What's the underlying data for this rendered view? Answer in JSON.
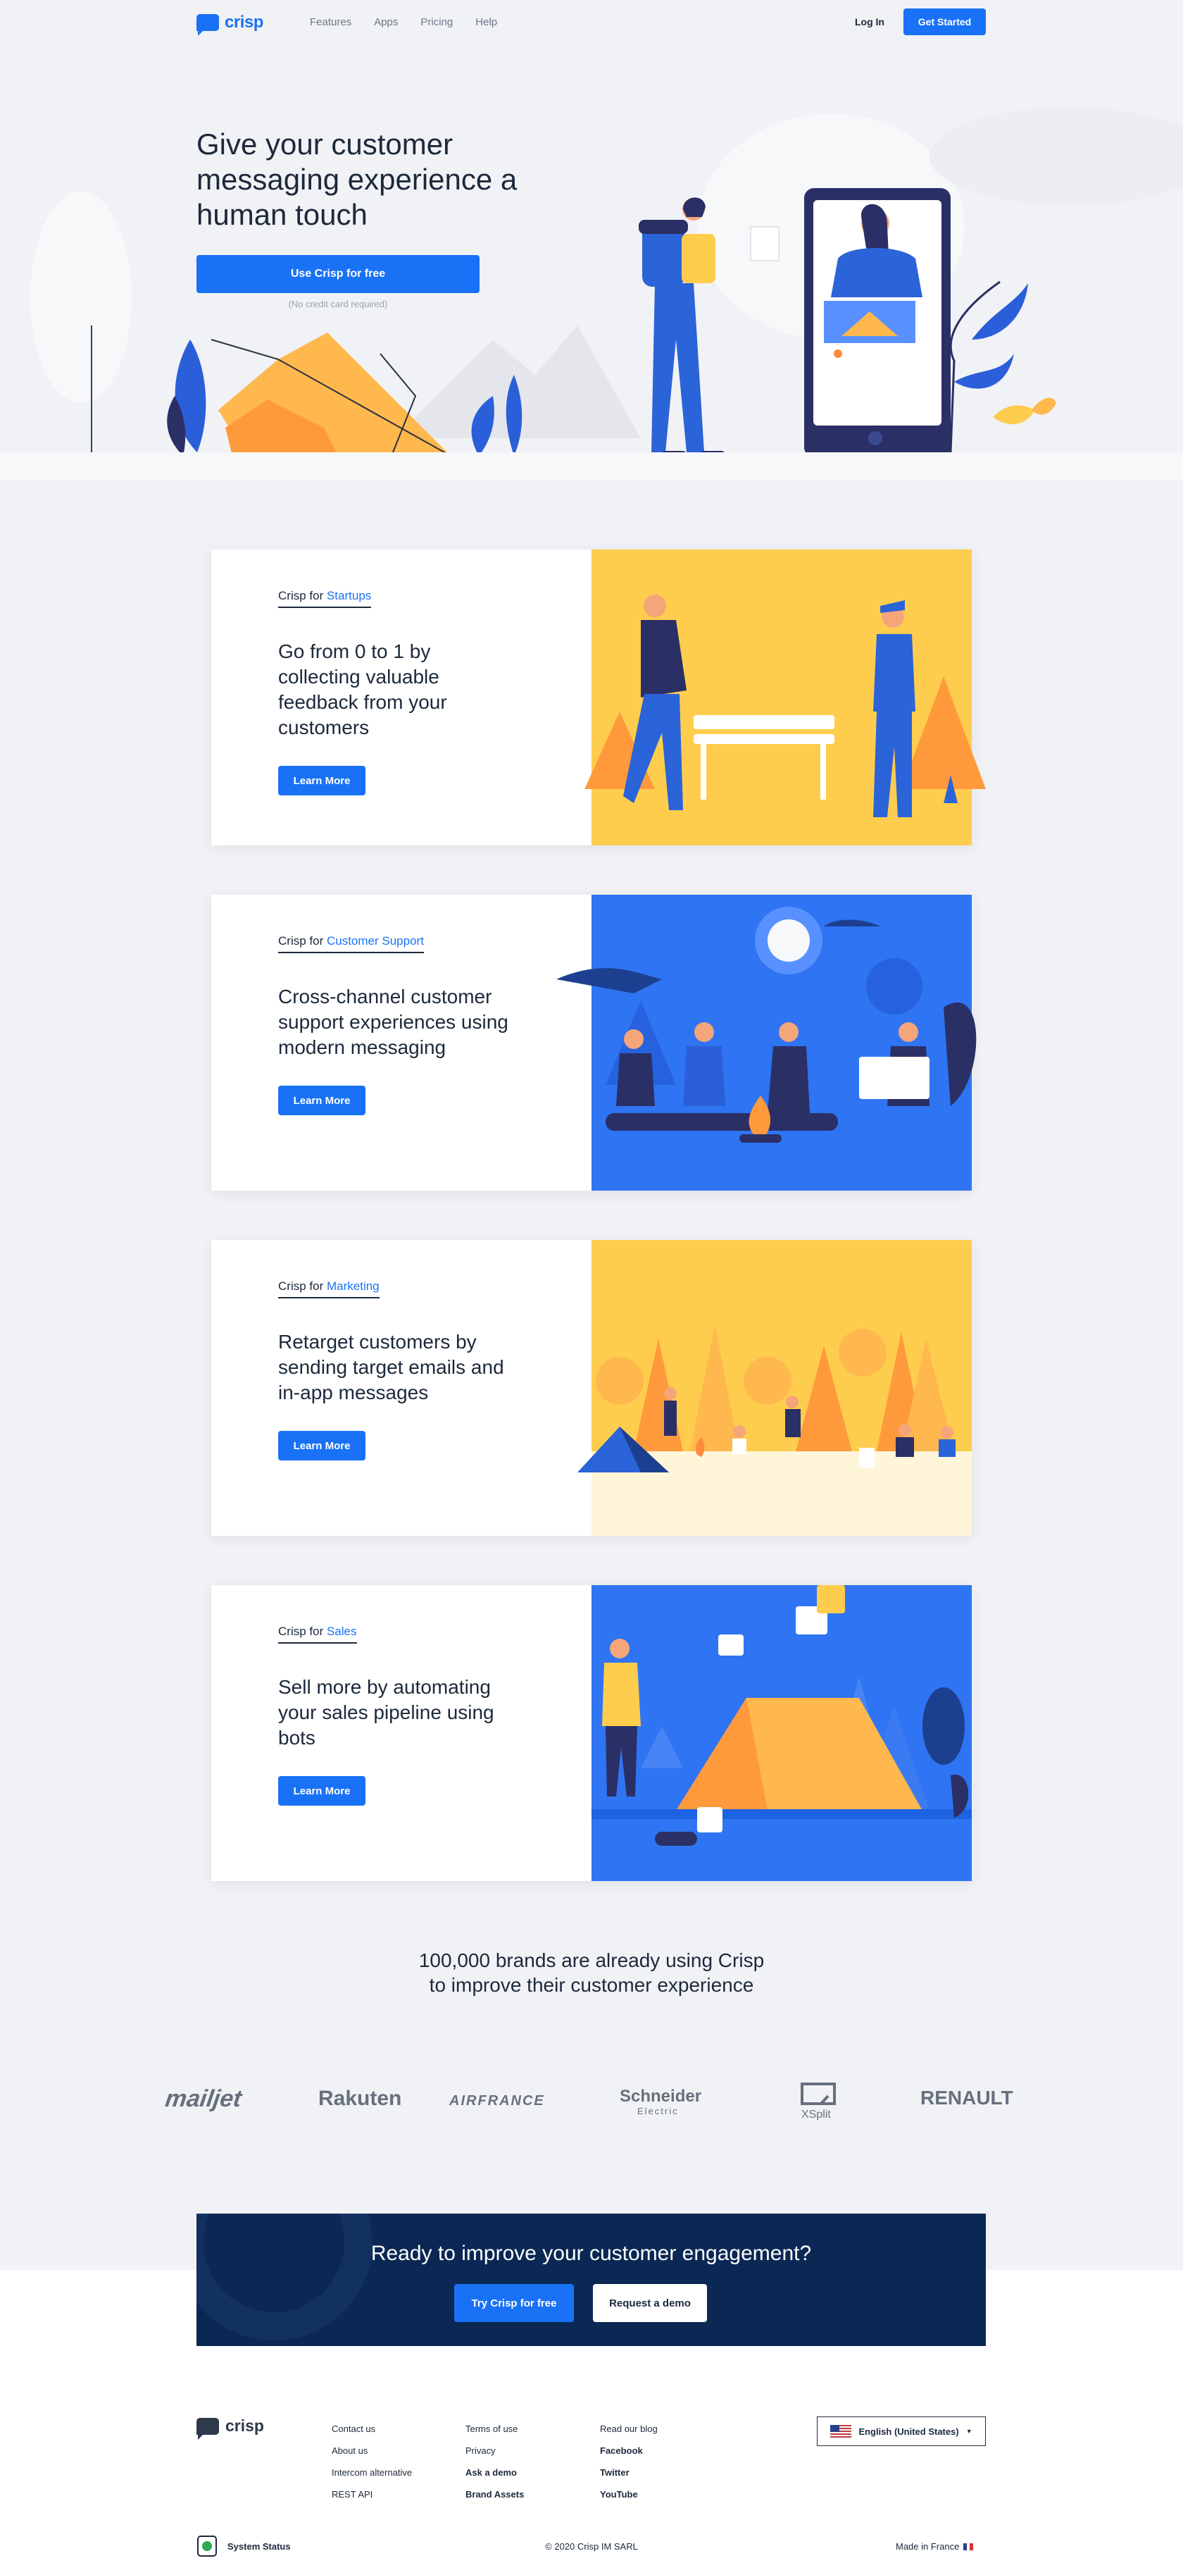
{
  "nav": {
    "logo_text": "crisp",
    "links": [
      "Features",
      "Apps",
      "Pricing",
      "Help"
    ],
    "login": "Log In",
    "get_started": "Get Started"
  },
  "hero": {
    "title": "Give your customer messaging experience a human touch",
    "cta": "Use Crisp for free",
    "sub": "(No credit card required)"
  },
  "cards": [
    {
      "kicker_prefix": "Crisp for",
      "kicker_highlight": "Startups",
      "heading": "Go from 0 to 1 by collecting valuable feedback from your customers",
      "button": "Learn More"
    },
    {
      "kicker_prefix": "Crisp for",
      "kicker_highlight": "Customer Support",
      "heading": "Cross-channel customer support experiences using modern messaging",
      "button": "Learn More"
    },
    {
      "kicker_prefix": "Crisp for",
      "kicker_highlight": "Marketing",
      "heading": "Retarget customers by sending target emails and in-app messages",
      "button": "Learn More"
    },
    {
      "kicker_prefix": "Crisp for",
      "kicker_highlight": "Sales",
      "heading": "Sell more by automating your sales pipeline using bots",
      "button": "Learn More"
    }
  ],
  "brands": {
    "title": "100,000 brands are already using Crisp to improve their customer experience",
    "logos": [
      "mailjet",
      "Rakuten",
      "AIRFRANCE",
      "Schneider",
      "Electric",
      "XSplit",
      "RENAULT"
    ]
  },
  "cta": {
    "title": "Ready to improve your customer engagement?",
    "primary": "Try Crisp for free",
    "secondary": "Request a demo"
  },
  "footer": {
    "logo_text": "crisp",
    "col1": [
      "Contact us",
      "About us",
      "Intercom alternative",
      "REST API"
    ],
    "col2": [
      "Terms of use",
      "Privacy",
      "Ask a demo",
      "Brand Assets"
    ],
    "col3": [
      "Read our blog",
      "Facebook",
      "Twitter",
      "YouTube"
    ],
    "language": "English (United States)",
    "system_status": "System Status",
    "copyright": "© 2020 Crisp IM SARL",
    "made_in": "Made in France"
  },
  "colors": {
    "brand_blue": "#1972f5",
    "navy": "#0a2853",
    "yellow": "#ffcd4d",
    "text": "#1c293b"
  }
}
